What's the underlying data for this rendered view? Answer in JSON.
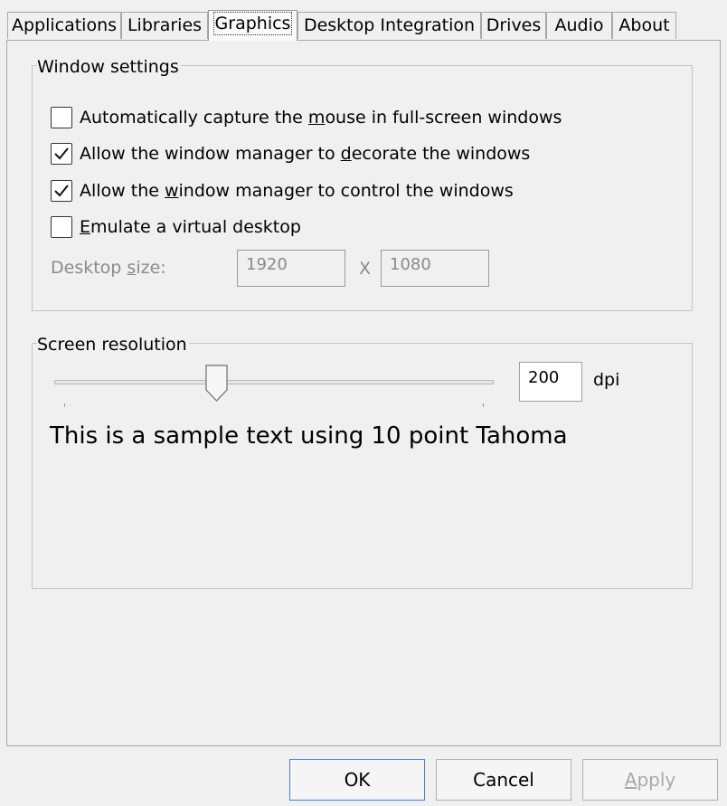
{
  "tabs": [
    "Applications",
    "Libraries",
    "Graphics",
    "Desktop Integration",
    "Drives",
    "Audio",
    "About"
  ],
  "active_tab": "Graphics",
  "window_settings": {
    "title": "Window settings",
    "capture_mouse": {
      "pre": "Automatically capture the ",
      "key": "m",
      "post": "ouse in full-screen windows",
      "checked": false
    },
    "decorate": {
      "pre": "Allow the window manager to ",
      "key": "d",
      "post": "ecorate the windows",
      "checked": true
    },
    "control": {
      "pre": "Allow the ",
      "key": "w",
      "post": "indow manager to control the windows",
      "checked": true
    },
    "virtual_desktop": {
      "pre": "",
      "key": "E",
      "post": "mulate a virtual desktop",
      "checked": false
    },
    "desktop_size": {
      "pre": "Desktop ",
      "key": "s",
      "post": "ize:",
      "width": "1920",
      "separator": "X",
      "height": "1080"
    }
  },
  "screen_resolution": {
    "title": "Screen resolution",
    "dpi_value": "200",
    "dpi_unit": "dpi",
    "slider_fraction": 0.37,
    "sample_text": "This is a sample text using 10 point Tahoma"
  },
  "buttons": {
    "ok": "OK",
    "cancel": "Cancel",
    "apply_key": "A",
    "apply_rest": "pply"
  }
}
